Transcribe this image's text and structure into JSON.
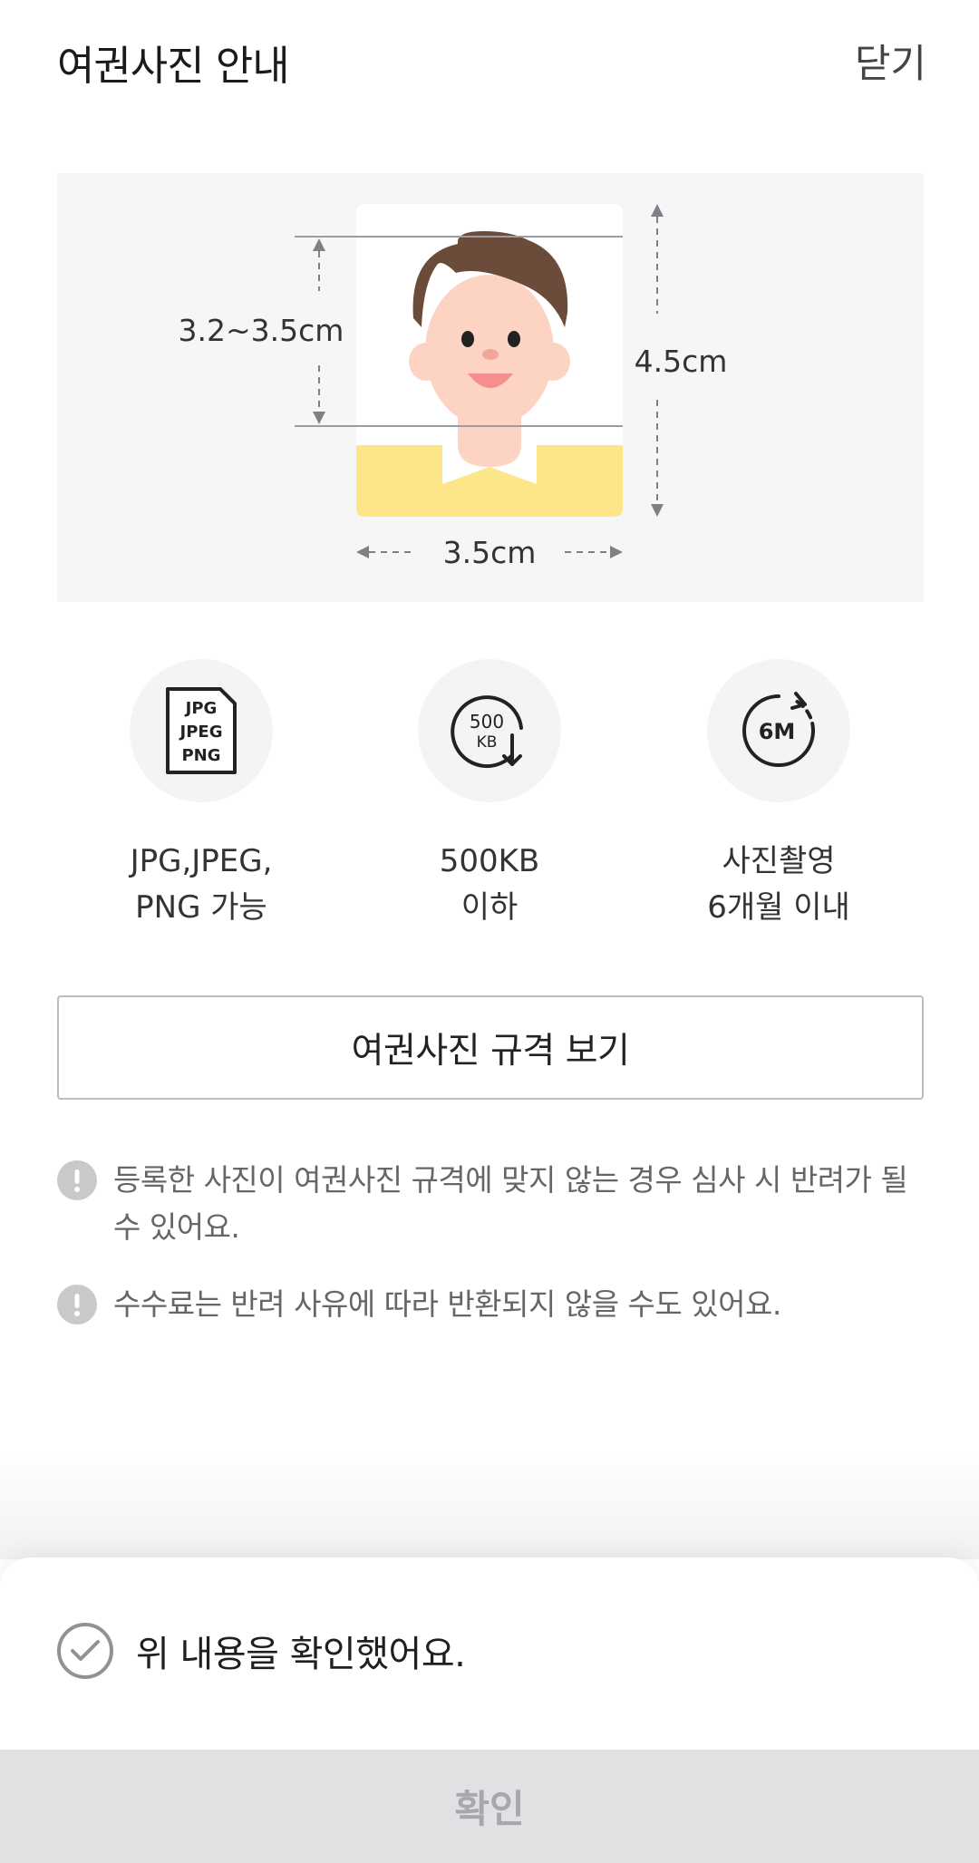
{
  "header": {
    "title": "여권사진 안내",
    "close_label": "닫기"
  },
  "illustration": {
    "face_height_label": "3.2~3.5cm",
    "photo_height_label": "4.5cm",
    "photo_width_label": "3.5cm"
  },
  "requirements": [
    {
      "icon": "file-format-icon",
      "icon_text": [
        "JPG",
        "JPEG",
        "PNG"
      ],
      "line1": "JPG,JPEG,",
      "line2": "PNG 가능"
    },
    {
      "icon": "file-size-icon",
      "icon_text": [
        "500",
        "KB"
      ],
      "line1": "500KB",
      "line2": "이하"
    },
    {
      "icon": "six-months-icon",
      "icon_text": [
        "6M"
      ],
      "line1": "사진촬영",
      "line2": "6개월 이내"
    }
  ],
  "spec_button_label": "여권사진 규격 보기",
  "notices": [
    {
      "text": "등록한 사진이 여권사진 규격에 맞지 않는 경우 심사 시 반려가 될 수 있어요."
    },
    {
      "text": "수수료는 반려 사유에 따라 반환되지 않을 수도 있어요."
    }
  ],
  "confirm": {
    "label": "위 내용을 확인했어요.",
    "checked": false
  },
  "ok_button_label": "확인",
  "colors": {
    "illustration_bg": "#f6f6f7",
    "shirt": "#fde58a",
    "hair": "#6b4c3b",
    "skin": "#fdd3c4",
    "ok_bg": "#e0e1e3",
    "ok_text": "#a6a8ad"
  }
}
